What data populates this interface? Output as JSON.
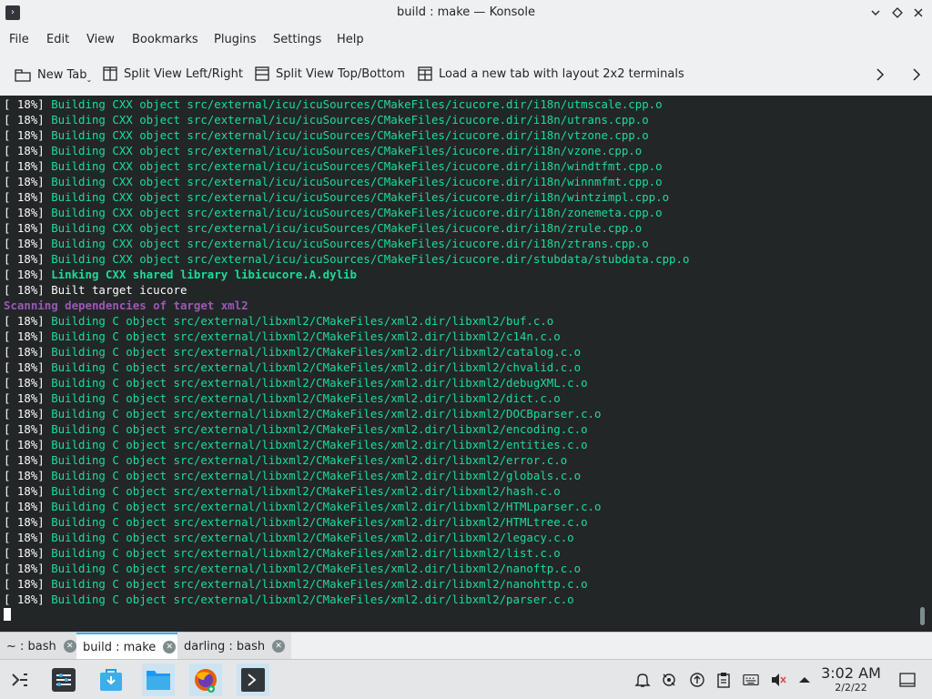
{
  "window": {
    "title": "build : make — Konsole",
    "app_icon": "terminal-icon"
  },
  "menu": [
    "File",
    "Edit",
    "View",
    "Bookmarks",
    "Plugins",
    "Settings",
    "Help"
  ],
  "toolbar": {
    "new_tab": "New Tab",
    "split_lr": "Split View Left/Right",
    "split_tb": "Split View Top/Bottom",
    "layout_2x2": "Load a new tab with layout 2x2 terminals"
  },
  "terminal": {
    "lines": [
      {
        "p": "[ 18%] ",
        "t": "Building CXX object src/external/icu/icuSources/CMakeFiles/icucore.dir/i18n/utmscale.cpp.o",
        "c": "gr"
      },
      {
        "p": "[ 18%] ",
        "t": "Building CXX object src/external/icu/icuSources/CMakeFiles/icucore.dir/i18n/utrans.cpp.o",
        "c": "gr"
      },
      {
        "p": "[ 18%] ",
        "t": "Building CXX object src/external/icu/icuSources/CMakeFiles/icucore.dir/i18n/vtzone.cpp.o",
        "c": "gr"
      },
      {
        "p": "[ 18%] ",
        "t": "Building CXX object src/external/icu/icuSources/CMakeFiles/icucore.dir/i18n/vzone.cpp.o",
        "c": "gr"
      },
      {
        "p": "[ 18%] ",
        "t": "Building CXX object src/external/icu/icuSources/CMakeFiles/icucore.dir/i18n/windtfmt.cpp.o",
        "c": "gr"
      },
      {
        "p": "[ 18%] ",
        "t": "Building CXX object src/external/icu/icuSources/CMakeFiles/icucore.dir/i18n/winnmfmt.cpp.o",
        "c": "gr"
      },
      {
        "p": "[ 18%] ",
        "t": "Building CXX object src/external/icu/icuSources/CMakeFiles/icucore.dir/i18n/wintzimpl.cpp.o",
        "c": "gr"
      },
      {
        "p": "[ 18%] ",
        "t": "Building CXX object src/external/icu/icuSources/CMakeFiles/icucore.dir/i18n/zonemeta.cpp.o",
        "c": "gr"
      },
      {
        "p": "[ 18%] ",
        "t": "Building CXX object src/external/icu/icuSources/CMakeFiles/icucore.dir/i18n/zrule.cpp.o",
        "c": "gr"
      },
      {
        "p": "[ 18%] ",
        "t": "Building CXX object src/external/icu/icuSources/CMakeFiles/icucore.dir/i18n/ztrans.cpp.o",
        "c": "gr"
      },
      {
        "p": "[ 18%] ",
        "t": "Building CXX object src/external/icu/icuSources/CMakeFiles/icucore.dir/stubdata/stubdata.cpp.o",
        "c": "gr"
      },
      {
        "p": "[ 18%] ",
        "t": "Linking CXX shared library libicucore.A.dylib",
        "c": "gb"
      },
      {
        "p": "[ 18%] ",
        "t": "Built target icucore",
        "c": "wh"
      },
      {
        "p": "",
        "t": "Scanning dependencies of target xml2",
        "c": "pb"
      },
      {
        "p": "[ 18%] ",
        "t": "Building C object src/external/libxml2/CMakeFiles/xml2.dir/libxml2/buf.c.o",
        "c": "gr"
      },
      {
        "p": "[ 18%] ",
        "t": "Building C object src/external/libxml2/CMakeFiles/xml2.dir/libxml2/c14n.c.o",
        "c": "gr"
      },
      {
        "p": "[ 18%] ",
        "t": "Building C object src/external/libxml2/CMakeFiles/xml2.dir/libxml2/catalog.c.o",
        "c": "gr"
      },
      {
        "p": "[ 18%] ",
        "t": "Building C object src/external/libxml2/CMakeFiles/xml2.dir/libxml2/chvalid.c.o",
        "c": "gr"
      },
      {
        "p": "[ 18%] ",
        "t": "Building C object src/external/libxml2/CMakeFiles/xml2.dir/libxml2/debugXML.c.o",
        "c": "gr"
      },
      {
        "p": "[ 18%] ",
        "t": "Building C object src/external/libxml2/CMakeFiles/xml2.dir/libxml2/dict.c.o",
        "c": "gr"
      },
      {
        "p": "[ 18%] ",
        "t": "Building C object src/external/libxml2/CMakeFiles/xml2.dir/libxml2/DOCBparser.c.o",
        "c": "gr"
      },
      {
        "p": "[ 18%] ",
        "t": "Building C object src/external/libxml2/CMakeFiles/xml2.dir/libxml2/encoding.c.o",
        "c": "gr"
      },
      {
        "p": "[ 18%] ",
        "t": "Building C object src/external/libxml2/CMakeFiles/xml2.dir/libxml2/entities.c.o",
        "c": "gr"
      },
      {
        "p": "[ 18%] ",
        "t": "Building C object src/external/libxml2/CMakeFiles/xml2.dir/libxml2/error.c.o",
        "c": "gr"
      },
      {
        "p": "[ 18%] ",
        "t": "Building C object src/external/libxml2/CMakeFiles/xml2.dir/libxml2/globals.c.o",
        "c": "gr"
      },
      {
        "p": "[ 18%] ",
        "t": "Building C object src/external/libxml2/CMakeFiles/xml2.dir/libxml2/hash.c.o",
        "c": "gr"
      },
      {
        "p": "[ 18%] ",
        "t": "Building C object src/external/libxml2/CMakeFiles/xml2.dir/libxml2/HTMLparser.c.o",
        "c": "gr"
      },
      {
        "p": "[ 18%] ",
        "t": "Building C object src/external/libxml2/CMakeFiles/xml2.dir/libxml2/HTMLtree.c.o",
        "c": "gr"
      },
      {
        "p": "[ 18%] ",
        "t": "Building C object src/external/libxml2/CMakeFiles/xml2.dir/libxml2/legacy.c.o",
        "c": "gr"
      },
      {
        "p": "[ 18%] ",
        "t": "Building C object src/external/libxml2/CMakeFiles/xml2.dir/libxml2/list.c.o",
        "c": "gr"
      },
      {
        "p": "[ 18%] ",
        "t": "Building C object src/external/libxml2/CMakeFiles/xml2.dir/libxml2/nanoftp.c.o",
        "c": "gr"
      },
      {
        "p": "[ 18%] ",
        "t": "Building C object src/external/libxml2/CMakeFiles/xml2.dir/libxml2/nanohttp.c.o",
        "c": "gr"
      },
      {
        "p": "[ 18%] ",
        "t": "Building C object src/external/libxml2/CMakeFiles/xml2.dir/libxml2/parser.c.o",
        "c": "gr"
      }
    ]
  },
  "tabs": [
    {
      "label": "~ : bash",
      "active": false
    },
    {
      "label": "build : make",
      "active": true
    },
    {
      "label": "darling : bash",
      "active": false
    }
  ],
  "taskbar": {
    "apps": [
      "application-launcher-icon",
      "system-settings-icon",
      "discover-icon",
      "file-manager-icon",
      "firefox-icon",
      "konsole-icon"
    ],
    "tray": [
      "notifications-icon",
      "klipper-icon",
      "updates-icon",
      "clipboard-icon",
      "keyboard-icon",
      "volume-muted-icon",
      "tray-expand-icon"
    ],
    "time": "3:02 AM",
    "date": "2/2/22"
  },
  "colors": {
    "terminal_bg": "#232627",
    "green": "#1cdc9a",
    "purple": "#9b59b6",
    "accent": "#3daee9"
  }
}
